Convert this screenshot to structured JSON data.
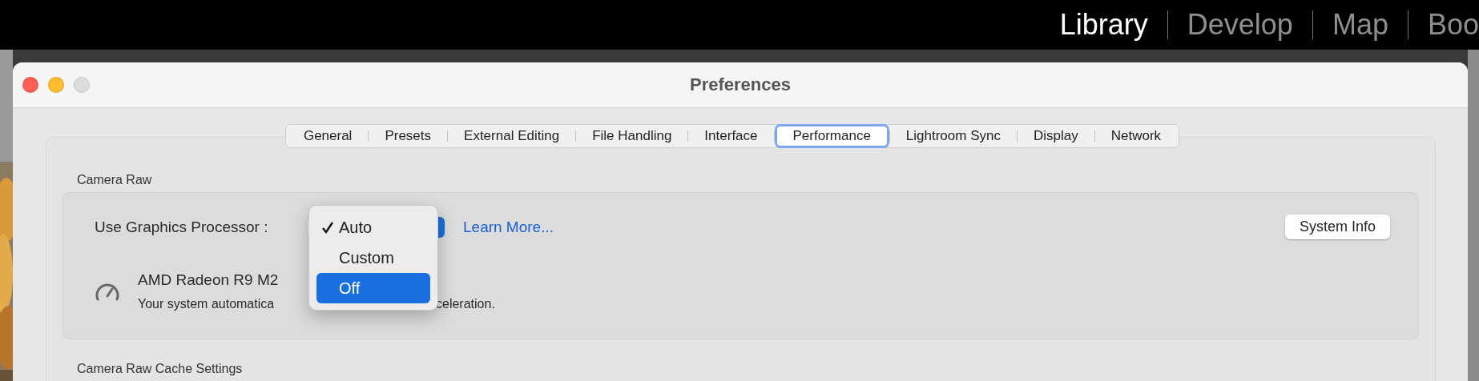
{
  "menu_bar": {
    "modules": [
      {
        "label": "Library",
        "selected": true
      },
      {
        "label": "Develop",
        "selected": false
      },
      {
        "label": "Map",
        "selected": false
      },
      {
        "label": "Boo",
        "selected": false
      }
    ]
  },
  "window": {
    "title": "Preferences",
    "controls": [
      {
        "color": "#fe5f57",
        "disabled": false
      },
      {
        "color": "#febc2e",
        "disabled": false
      },
      {
        "color": "#dcdcdc",
        "disabled": true
      }
    ]
  },
  "tabs": [
    {
      "label": "General",
      "selected": false
    },
    {
      "label": "Presets",
      "selected": false
    },
    {
      "label": "External Editing",
      "selected": false
    },
    {
      "label": "File Handling",
      "selected": false
    },
    {
      "label": "Interface",
      "selected": false
    },
    {
      "label": "Performance",
      "selected": true
    },
    {
      "label": "Lightroom Sync",
      "selected": false
    },
    {
      "label": "Display",
      "selected": false
    },
    {
      "label": "Network",
      "selected": false
    }
  ],
  "camera_raw": {
    "heading": "Camera Raw",
    "gpu_label": "Use Graphics Processor :",
    "learn_more": "Learn More...",
    "system_info": "System Info",
    "gpu_name": "AMD Radeon R9 M2",
    "status_left": "Your system automatica",
    "status_right": "celeration."
  },
  "gpu_menu": {
    "items": [
      {
        "label": "Auto",
        "checked": true,
        "selected": false
      },
      {
        "label": "Custom",
        "checked": false,
        "selected": false
      },
      {
        "label": "Off",
        "checked": false,
        "selected": true
      }
    ]
  },
  "next_section": {
    "heading": "Camera Raw Cache Settings"
  }
}
